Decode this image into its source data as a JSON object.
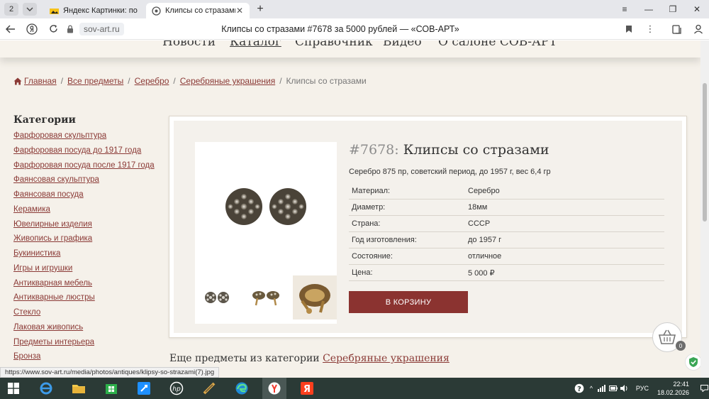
{
  "browser": {
    "tab_count": "2",
    "tabs": [
      {
        "label": "Яндекс Картинки: поиск"
      },
      {
        "label": "Клипсы со стразами #7678 за 5000 рублей — «СОВ-АРТ»"
      }
    ],
    "address": "sov-art.ru",
    "page_title": "Клипсы со стразами #7678 за 5000 рублей — «СОВ-АРТ»",
    "status_url": "https://www.sov-art.ru/media/photos/antiques/klipsy-so-strazami(7).jpg"
  },
  "nav": {
    "items": [
      "Новости",
      "Каталог",
      "Справочник",
      "Видео",
      "О салоне СОВ-АРТ"
    ]
  },
  "breadcrumb": {
    "items": [
      "Главная",
      "Все предметы",
      "Серебро",
      "Серебряные украшения"
    ],
    "current": "Клипсы со стразами"
  },
  "sidebar": {
    "title": "Категории",
    "items": [
      "Фарфоровая скульптура",
      "Фарфоровая посуда до 1917 года",
      "Фарфоровая посуда после 1917 года",
      "Фаянсовая скульптура",
      "Фаянсовая посуда",
      "Керамика",
      "Ювелирные изделия",
      "Живопись и графика",
      "Букинистика",
      "Игры и игрушки",
      "Антикварная мебель",
      "Антикварные люстры",
      "Стекло",
      "Лаковая живопись",
      "Предметы интерьера",
      "Бронза"
    ]
  },
  "product": {
    "number": "#7678:",
    "title": "Клипсы со стразами",
    "description": "Серебро 875 пр, советский период, до 1957 г, вес 6,4 гр",
    "specs": [
      {
        "key": "Материал:",
        "value": "Серебро"
      },
      {
        "key": "Диаметр:",
        "value": "18мм"
      },
      {
        "key": "Страна:",
        "value": "СССР"
      },
      {
        "key": "Год изготовления:",
        "value": "до 1957 г"
      },
      {
        "key": "Состояние:",
        "value": "отличное"
      },
      {
        "key": "Цена:",
        "value": "5 000 ₽"
      }
    ],
    "buy_label": "В КОРЗИНУ"
  },
  "more": {
    "prefix": "Еще предметы из категории",
    "link": "Серебряные украшения"
  },
  "cart": {
    "count": "0"
  },
  "taskbar": {
    "lang": "РУС",
    "time": "22:41",
    "date": "18.02.2026"
  },
  "colors": {
    "accent": "#8b3330",
    "page_bg": "#f5f1ea",
    "link": "#8b3a36"
  }
}
